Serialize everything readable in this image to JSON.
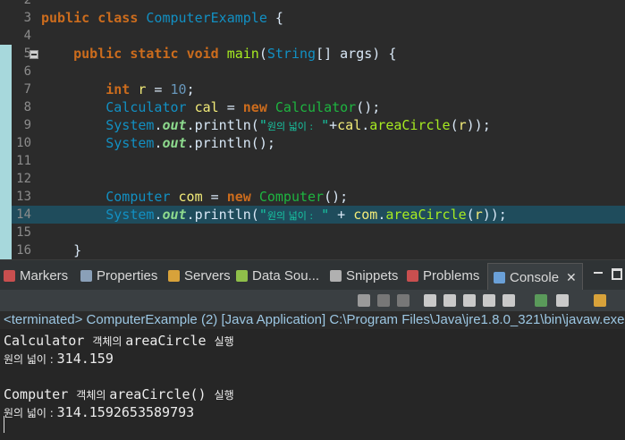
{
  "editor": {
    "lines": [
      {
        "n": "2"
      },
      {
        "n": "3",
        "tokens": [
          [
            "kw",
            "public "
          ],
          [
            "kw",
            "class "
          ],
          [
            "ty",
            "ComputerExample"
          ],
          [
            "pl",
            " {"
          ]
        ]
      },
      {
        "n": "4"
      },
      {
        "n": "5",
        "fold": true,
        "tokens": [
          [
            "pl",
            "    "
          ],
          [
            "kw",
            "public "
          ],
          [
            "kw",
            "static "
          ],
          [
            "kw",
            "void "
          ],
          [
            "mth",
            "main"
          ],
          [
            "pl",
            "("
          ],
          [
            "ty",
            "String"
          ],
          [
            "pl",
            "[] args) {"
          ]
        ]
      },
      {
        "n": "6"
      },
      {
        "n": "7",
        "tokens": [
          [
            "pl",
            "        "
          ],
          [
            "kw",
            "int "
          ],
          [
            "var",
            "r"
          ],
          [
            "pl",
            " = "
          ],
          [
            "num",
            "10"
          ],
          [
            "pl",
            ";"
          ]
        ]
      },
      {
        "n": "8",
        "tokens": [
          [
            "pl",
            "        "
          ],
          [
            "ty",
            "Calculator "
          ],
          [
            "var",
            "cal"
          ],
          [
            "pl",
            " = "
          ],
          [
            "kw",
            "new "
          ],
          [
            "cls",
            "Calculator"
          ],
          [
            "pl",
            "();"
          ]
        ]
      },
      {
        "n": "9",
        "tokens": [
          [
            "pl",
            "        "
          ],
          [
            "ty",
            "System"
          ],
          [
            "pl",
            "."
          ],
          [
            "fld",
            "out"
          ],
          [
            "pl",
            "."
          ],
          [
            "pl",
            "println("
          ],
          [
            "str",
            "\""
          ],
          [
            "str ko",
            "원의 넓이 :"
          ],
          [
            "str",
            " \""
          ],
          [
            "pl",
            "+"
          ],
          [
            "var",
            "cal"
          ],
          [
            "pl",
            "."
          ],
          [
            "mth",
            "areaCircle"
          ],
          [
            "pl",
            "("
          ],
          [
            "var",
            "r"
          ],
          [
            "pl",
            "));"
          ]
        ]
      },
      {
        "n": "10",
        "tokens": [
          [
            "pl",
            "        "
          ],
          [
            "ty",
            "System"
          ],
          [
            "pl",
            "."
          ],
          [
            "fld",
            "out"
          ],
          [
            "pl",
            "."
          ],
          [
            "pl",
            "println();"
          ]
        ]
      },
      {
        "n": "11"
      },
      {
        "n": "12"
      },
      {
        "n": "13",
        "tokens": [
          [
            "pl",
            "        "
          ],
          [
            "ty",
            "Computer "
          ],
          [
            "var",
            "com"
          ],
          [
            "pl",
            " = "
          ],
          [
            "kw",
            "new "
          ],
          [
            "cls",
            "Computer"
          ],
          [
            "pl",
            "();"
          ]
        ]
      },
      {
        "n": "14",
        "highlight": true,
        "tokens": [
          [
            "pl",
            "        "
          ],
          [
            "ty",
            "System"
          ],
          [
            "pl",
            "."
          ],
          [
            "fld",
            "out"
          ],
          [
            "pl",
            "."
          ],
          [
            "pl",
            "println("
          ],
          [
            "str",
            "\""
          ],
          [
            "str ko",
            "원의 넓이 :"
          ],
          [
            "str",
            " \""
          ],
          [
            "pl",
            " + "
          ],
          [
            "var",
            "com"
          ],
          [
            "pl",
            "."
          ],
          [
            "mth",
            "areaCircle"
          ],
          [
            "pl",
            "("
          ],
          [
            "var",
            "r"
          ],
          [
            "pl",
            "));"
          ]
        ]
      },
      {
        "n": "15"
      },
      {
        "n": "16",
        "tokens": [
          [
            "pl",
            "    }"
          ]
        ]
      }
    ]
  },
  "tabs": {
    "markers": "Markers",
    "properties": "Properties",
    "servers": "Servers",
    "datasource": "Data Sou...",
    "snippets": "Snippets",
    "problems": "Problems",
    "console": "Console",
    "close": "✕"
  },
  "colors": {
    "markers": "#c94f4f",
    "properties": "#8aa0b8",
    "servers": "#d8a23a",
    "datasource": "#8fbf4a",
    "snippets": "#b0b0b0",
    "problems": "#c94f4f",
    "console": "#6aa0d8"
  },
  "status": "<terminated> ComputerExample (2) [Java Application] C:\\Program Files\\Java\\jre1.8.0_321\\bin\\javaw.exe",
  "console": {
    "line1_prefix": "Calculator ",
    "line1_ko": "객체의 ",
    "line1_suffix": "areaCircle ",
    "line1_end": "실행",
    "line2_ko": "원의 넓이 : ",
    "line2_val": "314.159",
    "line3_prefix": "Computer ",
    "line3_ko": "객체의 ",
    "line3_suffix": "areaCircle() ",
    "line3_end": "실행",
    "line4_ko": "원의 넓이 : ",
    "line4_val": "314.1592653589793"
  }
}
